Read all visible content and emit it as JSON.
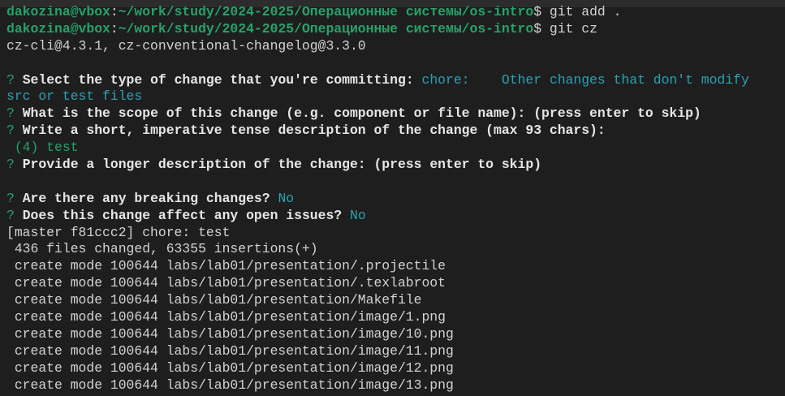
{
  "prompt": {
    "user_host": "dakozina@vbox",
    "path": "~/work/study/2024-2025/Операционные системы/os-intro",
    "symbol": "$"
  },
  "commands": [
    "git add .",
    "git cz"
  ],
  "version_line": "cz-cli@4.3.1, cz-conventional-changelog@3.3.0",
  "questions": [
    {
      "q": "Select the type of change that you're committing:",
      "answer": "chore:    Other changes that don't modify",
      "answer_cont": "src or test files"
    },
    {
      "q": "What is the scope of this change (e.g. component or file name): (press enter to skip)"
    },
    {
      "q": "Write a short, imperative tense description of the change (max 93 chars):",
      "answer": " (4) test"
    },
    {
      "q": "Provide a longer description of the change: (press enter to skip)"
    },
    {
      "q": "Are there any breaking changes?",
      "answer": "No"
    },
    {
      "q": "Does this change affect any open issues?",
      "answer": "No"
    }
  ],
  "question_mark": "?",
  "commit_line": "[master f81ccc2] chore: test",
  "summary_line": " 436 files changed, 63355 insertions(+)",
  "created_files": [
    " create mode 100644 labs/lab01/presentation/.projectile",
    " create mode 100644 labs/lab01/presentation/.texlabroot",
    " create mode 100644 labs/lab01/presentation/Makefile",
    " create mode 100644 labs/lab01/presentation/image/1.png",
    " create mode 100644 labs/lab01/presentation/image/10.png",
    " create mode 100644 labs/lab01/presentation/image/11.png",
    " create mode 100644 labs/lab01/presentation/image/12.png",
    " create mode 100644 labs/lab01/presentation/image/13.png"
  ],
  "colors": {
    "prompt": "#26a269",
    "answer": "#2aa1b3",
    "background": "#1e1e1e"
  }
}
